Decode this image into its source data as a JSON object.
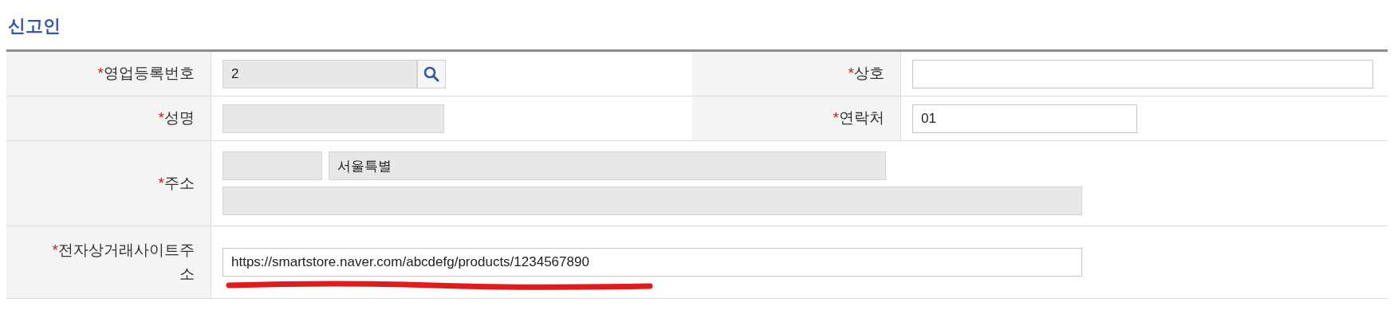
{
  "section_title": "신고인",
  "rows": [
    {
      "cells": [
        {
          "required_mark": "*",
          "label": "영업등록번호",
          "fields": [
            {
              "kind": "search",
              "value": "2",
              "disabled": true,
              "underlined": false
            }
          ]
        },
        {
          "required_mark": "*",
          "label": "상호",
          "fields": [
            {
              "kind": "text",
              "disabled": false,
              "underlined": false
            }
          ]
        }
      ]
    },
    {
      "cells": [
        {
          "required_mark": "*",
          "label": "성명",
          "fields": [
            {
              "kind": "text",
              "disabled": true,
              "underlined": false
            }
          ]
        },
        {
          "required_mark": "*",
          "label": "연락처",
          "fields": [
            {
              "kind": "text",
              "value": "01",
              "disabled": false,
              "underlined": false
            }
          ]
        }
      ]
    },
    {
      "cells": [
        {
          "required_mark": "*",
          "label": "주소",
          "fields": [
            {
              "kind": "text",
              "disabled": true,
              "underlined": false
            },
            {
              "kind": "text",
              "value": "서울특별",
              "disabled": true,
              "underlined": false
            },
            {
              "kind": "text",
              "disabled": true,
              "underlined": false
            }
          ]
        }
      ]
    },
    {
      "cells": [
        {
          "required_mark": "*",
          "label": "전자상거래사이트주소",
          "fields": [
            {
              "kind": "text",
              "value": "https://smartstore.naver.com/abcdefg/products/1234567890",
              "disabled": false,
              "underlined": true
            }
          ]
        }
      ]
    }
  ]
}
